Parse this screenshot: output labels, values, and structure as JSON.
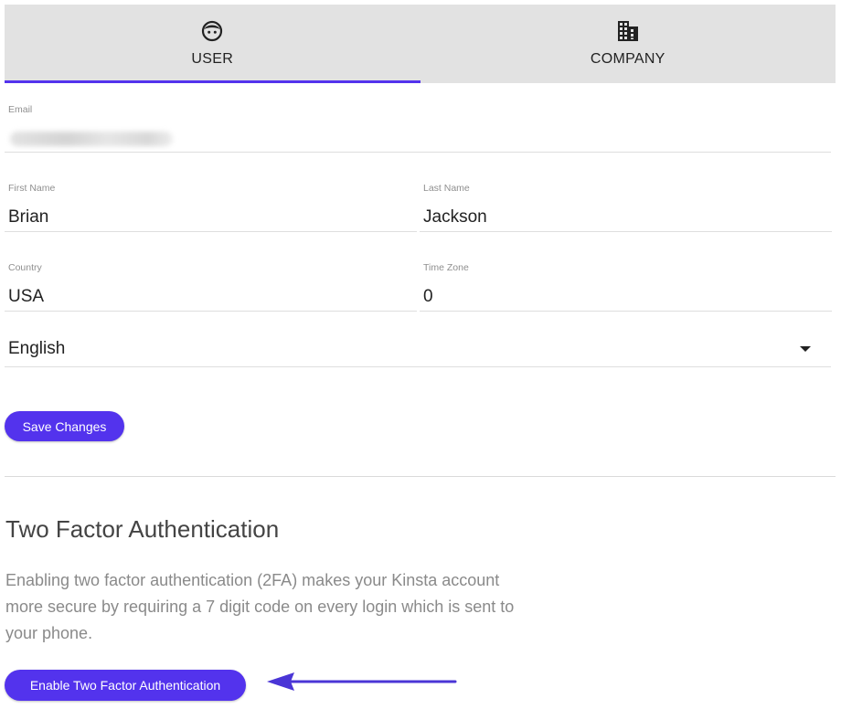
{
  "tabs": [
    {
      "label": "USER",
      "icon": "user-face-icon",
      "active": true
    },
    {
      "label": "COMPANY",
      "icon": "building-icon",
      "active": false
    }
  ],
  "form": {
    "email": {
      "label": "Email",
      "value": ""
    },
    "first_name": {
      "label": "First Name",
      "value": "Brian"
    },
    "last_name": {
      "label": "Last Name",
      "value": "Jackson"
    },
    "country": {
      "label": "Country",
      "value": "USA"
    },
    "time_zone": {
      "label": "Time Zone",
      "value": "0"
    },
    "language": {
      "value": "English"
    }
  },
  "save_button": {
    "label": "Save Changes"
  },
  "two_factor": {
    "title": "Two Factor Authentication",
    "description": "Enabling two factor authentication (2FA) makes your Kinsta account more secure by requiring a 7 digit code on every login which is sent to your phone.",
    "button_label": "Enable Two Factor Authentication"
  },
  "colors": {
    "accent": "#5333ed",
    "tab_bar_bg": "#e2e2e2",
    "annotation_arrow": "#4a35d6"
  }
}
